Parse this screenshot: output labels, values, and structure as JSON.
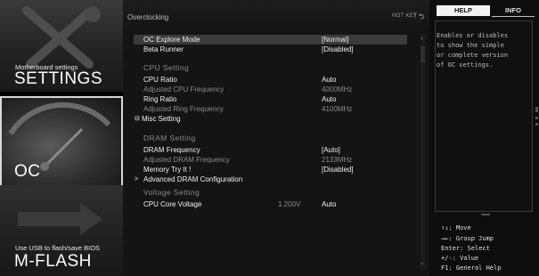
{
  "nav": {
    "settings": {
      "subtitle": "Motherboard settings",
      "title": "SETTINGS"
    },
    "oc": {
      "title": "OC"
    },
    "mflash": {
      "subtitle": "Use USB to flash/save BIOS",
      "title": "M-FLASH"
    }
  },
  "main": {
    "breadcrumb": "Overclocking",
    "hotkey_label": "HOT KEY",
    "hotkey_separator": "|",
    "back_icon": "back-arrow-icon",
    "rows": [
      {
        "label": "OC Explore Mode",
        "value": "[Normal]"
      },
      {
        "label": "Beta Runner",
        "value": "[Disabled]"
      },
      {
        "section": "CPU Setting"
      },
      {
        "label": "CPU Ratio",
        "value": "Auto"
      },
      {
        "label": "Adjusted CPU Frequency",
        "value": "4000MHz"
      },
      {
        "label": "Ring Ratio",
        "value": "Auto"
      },
      {
        "label": "Adjusted Ring Frequency",
        "value": "4100MHz"
      },
      {
        "prefix": "⊟",
        "label": "Misc Setting"
      },
      {
        "section": "DRAM Setting"
      },
      {
        "label": "DRAM Frequency",
        "value": "[Auto]"
      },
      {
        "label": "Adjusted DRAM Frequency",
        "value": "2133MHz"
      },
      {
        "label": "Memory Try It !",
        "value": "[Disabled]"
      },
      {
        "prefix": ">",
        "label": "Advanced DRAM Configuration"
      },
      {
        "section": "Voltage Setting"
      },
      {
        "label": "CPU Core Voltage",
        "current": "1.200V",
        "value": "Auto"
      }
    ]
  },
  "help": {
    "tabs": {
      "help": "HELP",
      "info": "INFO"
    },
    "text_lines": [
      "Enables or disables",
      "to show the simple",
      "or complete version",
      "of OC settings."
    ],
    "keys": [
      "↑↓: Move",
      "→←: Group Jump",
      "Enter: Select",
      "+/-: Value",
      "F1: General Help"
    ]
  },
  "colors": {
    "highlight": "#3b3b3b",
    "panel": "#141414",
    "oc_border": "#d8d8d8"
  }
}
